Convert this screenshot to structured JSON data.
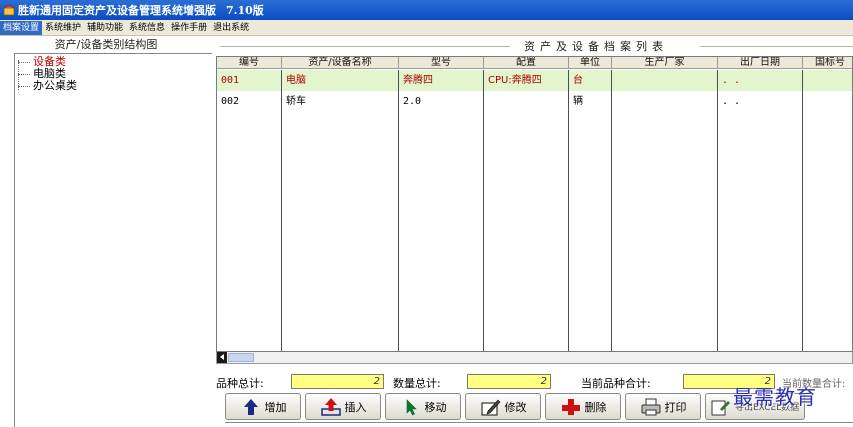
{
  "window": {
    "title": "胜新通用固定资产及设备管理系统增强版",
    "version": "7.10版"
  },
  "menu": [
    {
      "label": "档案设置",
      "active": true
    },
    {
      "label": "系统维护",
      "active": false
    },
    {
      "label": "辅助功能",
      "active": false
    },
    {
      "label": "系统信息",
      "active": false
    },
    {
      "label": "操作手册",
      "active": false
    },
    {
      "label": "退出系统",
      "active": false
    }
  ],
  "tree": {
    "title": "资产/设备类别结构图",
    "items": [
      {
        "label": "设备类",
        "selected": true
      },
      {
        "label": "电脑类",
        "selected": false
      },
      {
        "label": "办公桌类",
        "selected": false
      }
    ]
  },
  "list": {
    "title": "资产及设备档案列表",
    "columns": [
      "编号",
      "资产/设备名称",
      "型号",
      "配置",
      "单位",
      "生产厂家",
      "出厂日期",
      "国标号"
    ],
    "rows": [
      {
        "cells": [
          "001",
          "电脑",
          "奔腾四",
          "CPU:奔腾四",
          "台",
          "",
          ". .",
          ""
        ],
        "highlight": true
      },
      {
        "cells": [
          "002",
          "轿车",
          "2.0",
          "",
          "辆",
          "",
          ". .",
          ""
        ],
        "highlight": false
      }
    ]
  },
  "summary": {
    "kinds_label": "品种总计:",
    "kinds_value": "2",
    "qty_label": "数量总计:",
    "qty_value": "2",
    "current_label": "当前品种合计:",
    "current_value": "2",
    "truncated_label": "当前数量合计:"
  },
  "buttons": [
    {
      "label": "增加",
      "icon": "up-arrow-icon"
    },
    {
      "label": "插入",
      "icon": "insert-icon"
    },
    {
      "label": "移动",
      "icon": "cursor-icon"
    },
    {
      "label": "修改",
      "icon": "edit-icon"
    },
    {
      "label": "删除",
      "icon": "delete-icon"
    },
    {
      "label": "打印",
      "icon": "printer-icon"
    },
    {
      "label": "导出EXCEL数据",
      "icon": "export-icon"
    }
  ],
  "watermark": "最需教育",
  "colors": {
    "titlebar": "#0a4cc2",
    "menu_active": "#316ac5",
    "row_highlight": "#e2f5cc",
    "highlight_text": "#b00000",
    "summary_field": "#ffff80"
  }
}
